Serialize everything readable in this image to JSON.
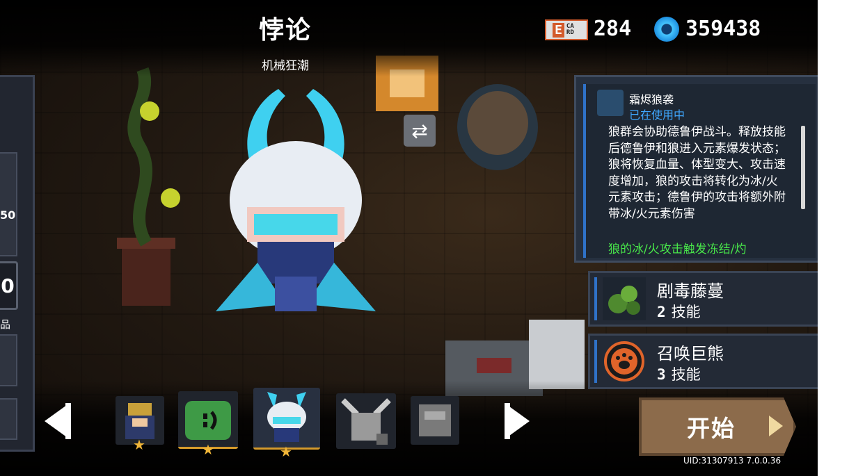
{
  "header": {
    "character_title": "悖论",
    "skin_name": "机械狂潮"
  },
  "currency": {
    "gem_badge_text": "E",
    "gem_badge_small": "CA RD",
    "gems": "284",
    "coins": "359438",
    "coin_icon": "blue-coin-icon"
  },
  "left_panel": {
    "stat_partial": "50",
    "badge_partial": "0",
    "label_partial": "品"
  },
  "skill_panel": {
    "skill_name": "霜烬狼袭",
    "status": "已在使用中",
    "description": "狼群会协助德鲁伊战斗。释放技能后德鲁伊和狼进入元素爆发状态；狼将恢复血量、体型变大、攻击速度增加，狼的攻击将转化为冰/火元素攻击；德鲁伊的攻击将额外附带冰/火元素伤害",
    "effect": "狼的冰/火攻击触发冻结/灼"
  },
  "skills": [
    {
      "name": "剧毒藤蔓",
      "level": "2",
      "level_label": "技能",
      "icon": "vine-icon"
    },
    {
      "name": "召唤巨熊",
      "level": "3",
      "level_label": "技能",
      "icon": "bear-paw-icon"
    }
  ],
  "carousel": {
    "left_arrow": "previous-arrow",
    "right_arrow": "next-arrow"
  },
  "start_button": {
    "label": "开始"
  },
  "footer": {
    "uid": "UID:31307913 7.0.0.36"
  },
  "colors": {
    "accent_blue": "#2f72c8",
    "effect_green": "#48e64a",
    "status_blue": "#3fa7ff",
    "start_brown": "#8c6b4b",
    "star_gold": "#f1b638"
  }
}
